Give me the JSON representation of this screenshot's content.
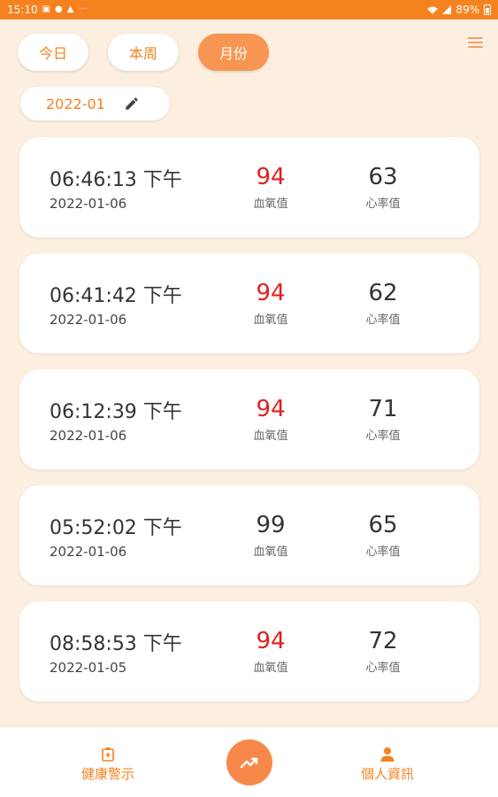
{
  "status_bar": {
    "time": "15:10",
    "battery": "89%"
  },
  "tabs": [
    {
      "label": "今日",
      "active": false
    },
    {
      "label": "本周",
      "active": false
    },
    {
      "label": "月份",
      "active": true
    }
  ],
  "month_selector": {
    "value": "2022-01"
  },
  "records": [
    {
      "time": "06:46:13 下午",
      "date": "2022-01-06",
      "spo2": "94",
      "spo2_label": "血氧值",
      "hr": "63",
      "hr_label": "心率值"
    },
    {
      "time": "06:41:42 下午",
      "date": "2022-01-06",
      "spo2": "94",
      "spo2_label": "血氧值",
      "hr": "62",
      "hr_label": "心率值"
    },
    {
      "time": "06:12:39 下午",
      "date": "2022-01-06",
      "spo2": "94",
      "spo2_label": "血氧值",
      "hr": "71",
      "hr_label": "心率值"
    },
    {
      "time": "05:52:02 下午",
      "date": "2022-01-06",
      "spo2": "99",
      "spo2_label": "血氧值",
      "hr": "65",
      "hr_label": "心率值"
    },
    {
      "time": "08:58:53 下午",
      "date": "2022-01-05",
      "spo2": "94",
      "spo2_label": "血氧值",
      "hr": "72",
      "hr_label": "心率值"
    }
  ],
  "spo2_alert_indices": [
    0,
    1,
    2,
    4
  ],
  "bottom_nav": {
    "health": {
      "label": "健康警示",
      "icon": "health-alert-icon"
    },
    "trend": {
      "icon": "trending-up-icon"
    },
    "profile": {
      "label": "個人資訊",
      "icon": "person-icon"
    }
  },
  "colors": {
    "accent": "#f5821f",
    "background": "#fdefe0",
    "alert": "#e02020"
  }
}
